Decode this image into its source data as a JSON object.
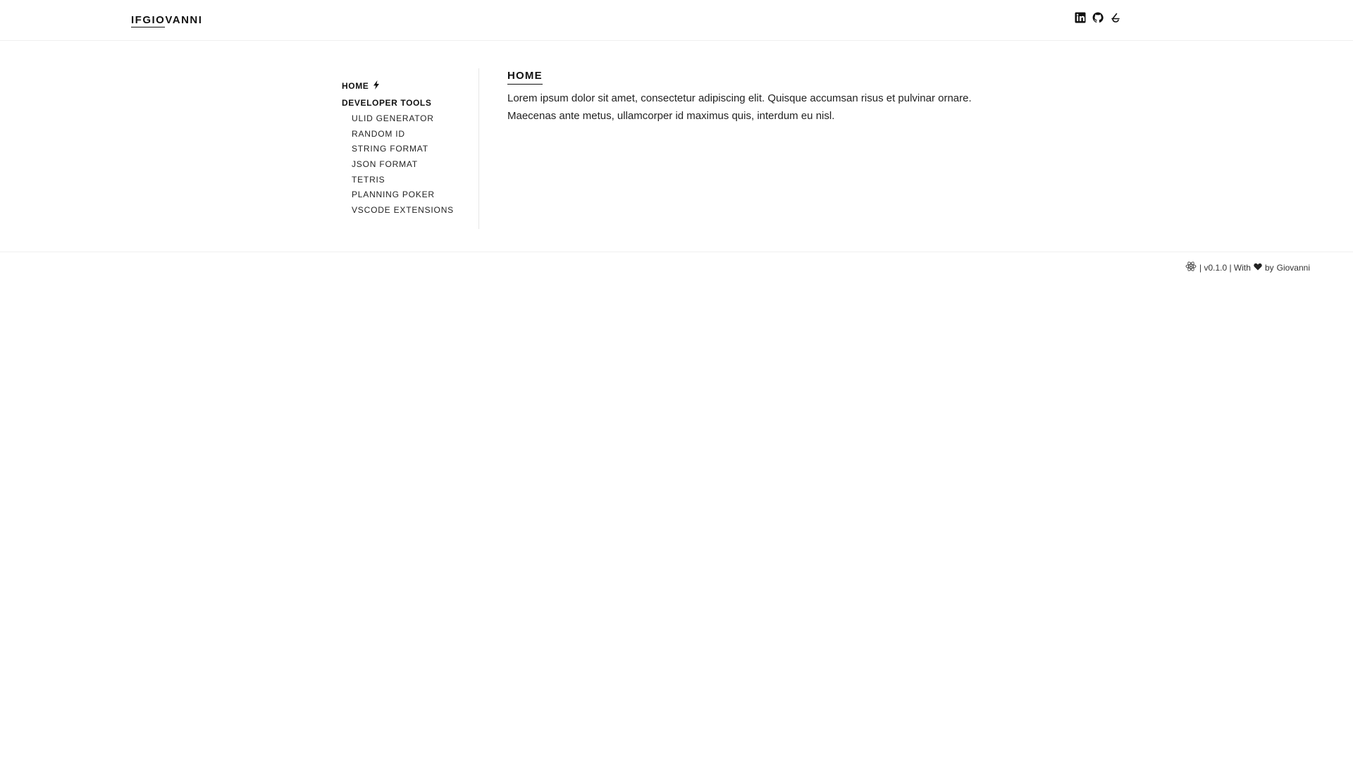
{
  "header": {
    "brand_prefix": "IFGIO",
    "brand_suffix": "VANNI",
    "social": [
      {
        "icon": "linkedin-icon"
      },
      {
        "icon": "github-icon"
      },
      {
        "icon": "dev-icon"
      }
    ]
  },
  "sidebar": {
    "home_label": "HOME",
    "group_label": "DEVELOPER TOOLS",
    "items": [
      {
        "label": "ULID GENERATOR"
      },
      {
        "label": "RANDOM ID"
      },
      {
        "label": "STRING FORMAT"
      },
      {
        "label": "JSON FORMAT"
      },
      {
        "label": "TETRIS"
      },
      {
        "label": "PLANNING POKER"
      },
      {
        "label": "VSCODE EXTENSIONS"
      }
    ]
  },
  "main": {
    "title": "HOME",
    "body": "Lorem ipsum dolor sit amet, consectetur adipiscing elit. Quisque accumsan risus et pulvinar ornare. Maecenas ante metus, ullamcorper id maximus quis, interdum eu nisl."
  },
  "footer": {
    "icon": "react-icon",
    "version_text": "| v0.1.0 | With",
    "heart_icon": "heart-icon",
    "by_text": "by",
    "author": "Giovanni"
  },
  "colors": {
    "text": "#111111",
    "border": "#e6e6e6"
  }
}
